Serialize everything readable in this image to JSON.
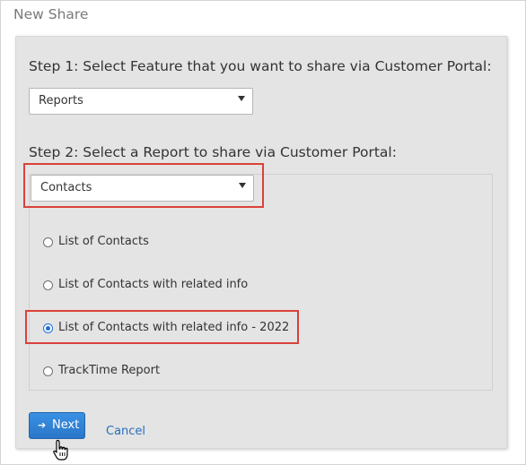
{
  "window": {
    "title": "New Share"
  },
  "step1": {
    "label": "Step 1: Select Feature that you want to share via Customer Portal:",
    "selected": "Reports"
  },
  "step2": {
    "label": "Step 2: Select a Report to share via Customer Portal:",
    "selected": "Contacts",
    "options": [
      {
        "label": "List of Contacts",
        "checked": false
      },
      {
        "label": "List of Contacts with related info",
        "checked": false
      },
      {
        "label": "List of Contacts with related info - 2022",
        "checked": true
      },
      {
        "label": "TrackTime Report",
        "checked": false
      }
    ]
  },
  "actions": {
    "next_label": "Next",
    "next_icon": "arrow-right-icon",
    "cancel_label": "Cancel"
  },
  "colors": {
    "highlight": "#d9423b",
    "primary": "#2a76c8",
    "link": "#2a6ebb"
  }
}
